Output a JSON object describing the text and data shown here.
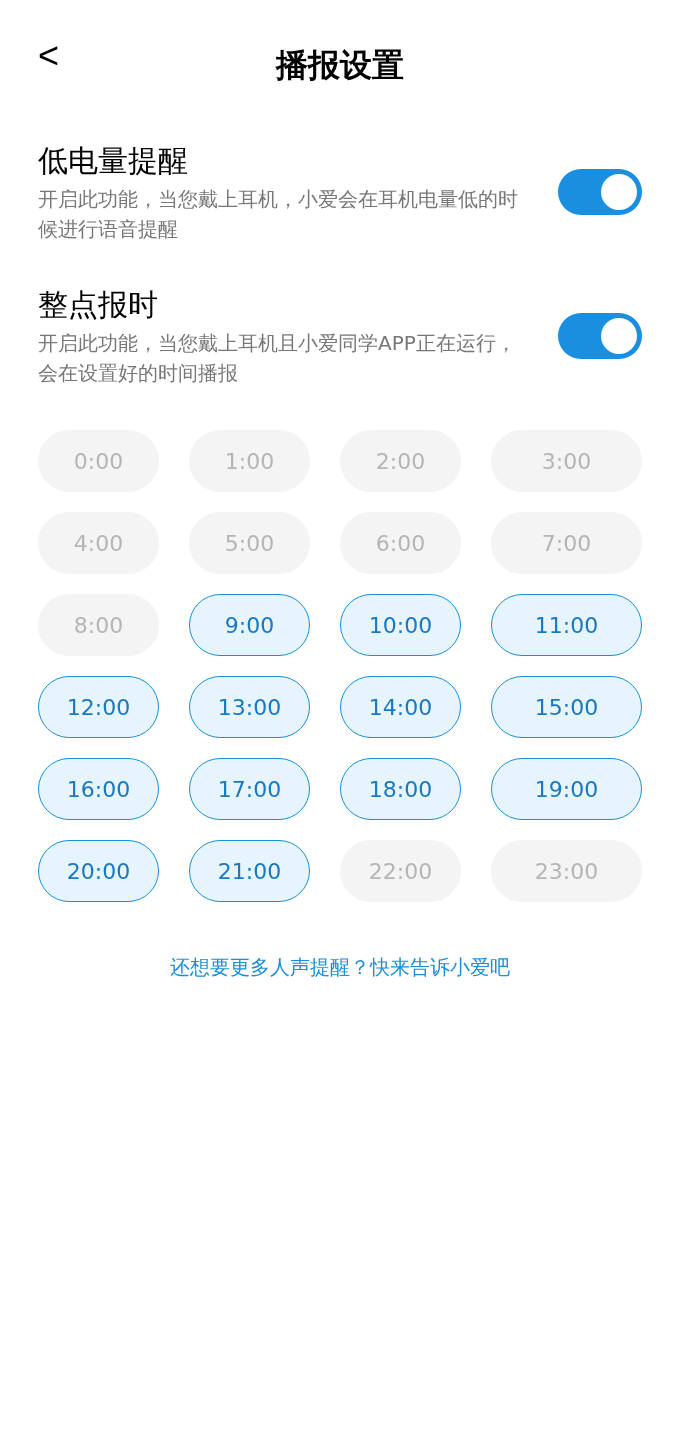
{
  "header": {
    "back": "<",
    "title": "播报设置"
  },
  "settings": [
    {
      "title": "低电量提醒",
      "description": "开启此功能，当您戴上耳机，小爱会在耳机电量低的时候进行语音提醒",
      "on": true
    },
    {
      "title": "整点报时",
      "description": "开启此功能，当您戴上耳机且小爱同学APP正在运行，会在设置好的时间播报",
      "on": true
    }
  ],
  "hours": [
    {
      "label": "0:00",
      "selected": false
    },
    {
      "label": "1:00",
      "selected": false
    },
    {
      "label": "2:00",
      "selected": false
    },
    {
      "label": "3:00",
      "selected": false
    },
    {
      "label": "4:00",
      "selected": false
    },
    {
      "label": "5:00",
      "selected": false
    },
    {
      "label": "6:00",
      "selected": false
    },
    {
      "label": "7:00",
      "selected": false
    },
    {
      "label": "8:00",
      "selected": false
    },
    {
      "label": "9:00",
      "selected": true
    },
    {
      "label": "10:00",
      "selected": true
    },
    {
      "label": "11:00",
      "selected": true
    },
    {
      "label": "12:00",
      "selected": true
    },
    {
      "label": "13:00",
      "selected": true
    },
    {
      "label": "14:00",
      "selected": true
    },
    {
      "label": "15:00",
      "selected": true
    },
    {
      "label": "16:00",
      "selected": true
    },
    {
      "label": "17:00",
      "selected": true
    },
    {
      "label": "18:00",
      "selected": true
    },
    {
      "label": "19:00",
      "selected": true
    },
    {
      "label": "20:00",
      "selected": true
    },
    {
      "label": "21:00",
      "selected": true
    },
    {
      "label": "22:00",
      "selected": false
    },
    {
      "label": "23:00",
      "selected": false
    }
  ],
  "feedback_link": "还想要更多人声提醒？快来告诉小爱吧"
}
